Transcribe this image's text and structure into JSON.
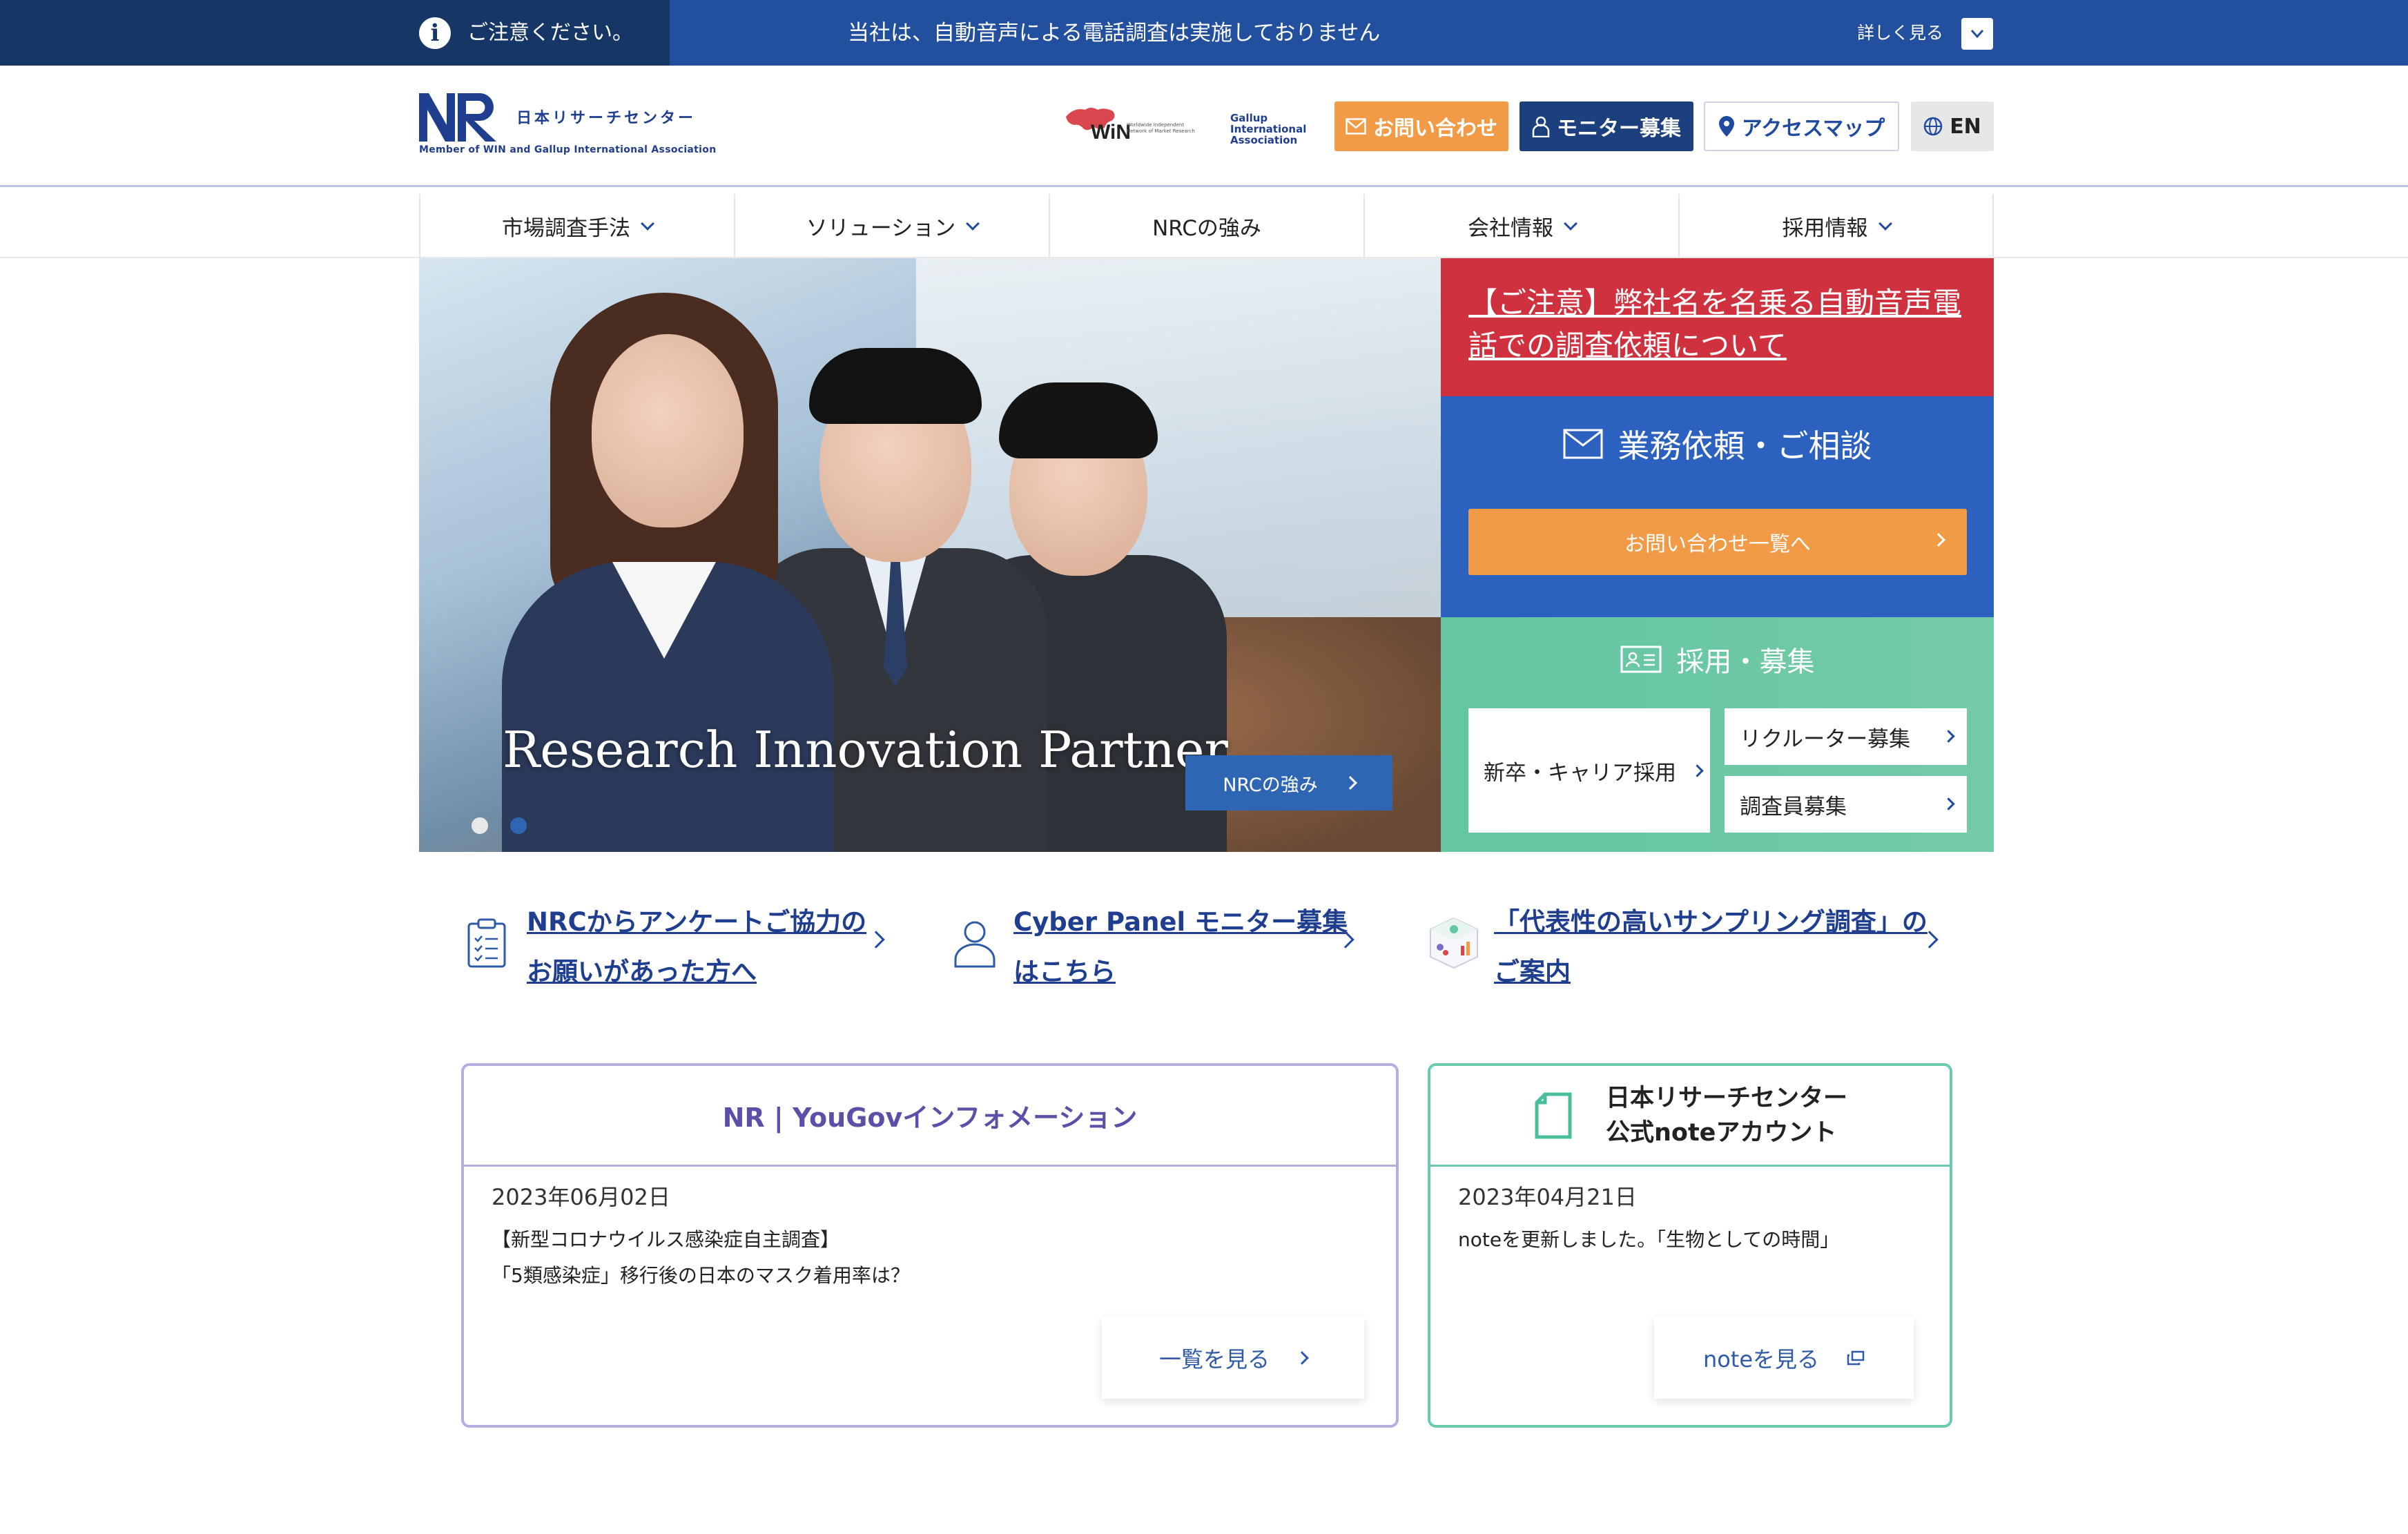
{
  "alert_bar": {
    "caution_label": "ご注意ください。",
    "message": "当社は、自動音声による電話調査は実施しておりません",
    "more_label": "詳しく見る",
    "colors": {
      "left": "#163766",
      "right": "#23509e"
    }
  },
  "header": {
    "logo": {
      "mark": "NR",
      "name_jp": "日本リサーチセンター",
      "subtitle": "Member of WIN and Gallup International Association"
    },
    "partner_logos": {
      "win": "WiN",
      "win_sub": "Worldwide Independent Network of Market Research",
      "gallup": [
        "Gallup",
        "International",
        "Association"
      ]
    },
    "buttons": {
      "contact": "お問い合わせ",
      "monitor": "モニター募集",
      "access": "アクセスマップ",
      "language": "EN"
    }
  },
  "nav": {
    "items": [
      {
        "label": "市場調査手法",
        "has_dropdown": true
      },
      {
        "label": "ソリューション",
        "has_dropdown": true
      },
      {
        "label": "NRCの強み",
        "has_dropdown": false
      },
      {
        "label": "会社情報",
        "has_dropdown": true
      },
      {
        "label": "採用情報",
        "has_dropdown": true
      }
    ]
  },
  "hero": {
    "tagline": "Research Innovation Partner",
    "button_label": "NRCの強み",
    "slide_count": 2,
    "active_slide": 2
  },
  "side_panels": {
    "alert_link": "【ご注意】弊社名を名乗る自動音声電話での調査依頼について",
    "business": {
      "title": "業務依頼・ご相談",
      "cta": "お問い合わせ一覧へ"
    },
    "recruit": {
      "title": "採用・募集",
      "buttons": [
        "新卒・キャリア採用",
        "リクルーター募集",
        "調査員募集"
      ]
    },
    "colors": {
      "alert": "#d0313f",
      "business": "#2c61c0",
      "cta": "#f29b47",
      "recruit": "#63c7a2"
    }
  },
  "quick_links": [
    {
      "line1": "NRCからアンケートご協力の",
      "line2": "お願いがあった方へ",
      "icon": "clipboard-icon"
    },
    {
      "line1": "Cyber Panel モニター募集",
      "line2": "はこちら",
      "icon": "person-icon"
    },
    {
      "line1": "「代表性の高いサンプリング調査」の",
      "line2": "ご案内",
      "icon": "cube-chart-icon"
    }
  ],
  "cards": {
    "yougov": {
      "title": "NR | YouGovインフォメーション",
      "date": "2023年06月02日",
      "body_line1": "【新型コロナウイルス感染症自主調査】",
      "body_line2": "「5類感染症」移行後の日本のマスク着用率は？",
      "more_label": "一覧を見る"
    },
    "note": {
      "title_line1": "日本リサーチセンター",
      "title_line2": "公式noteアカウント",
      "date": "2023年04月21日",
      "body": "noteを更新しました。「生物としての時間」",
      "more_label": "noteを見る"
    }
  }
}
